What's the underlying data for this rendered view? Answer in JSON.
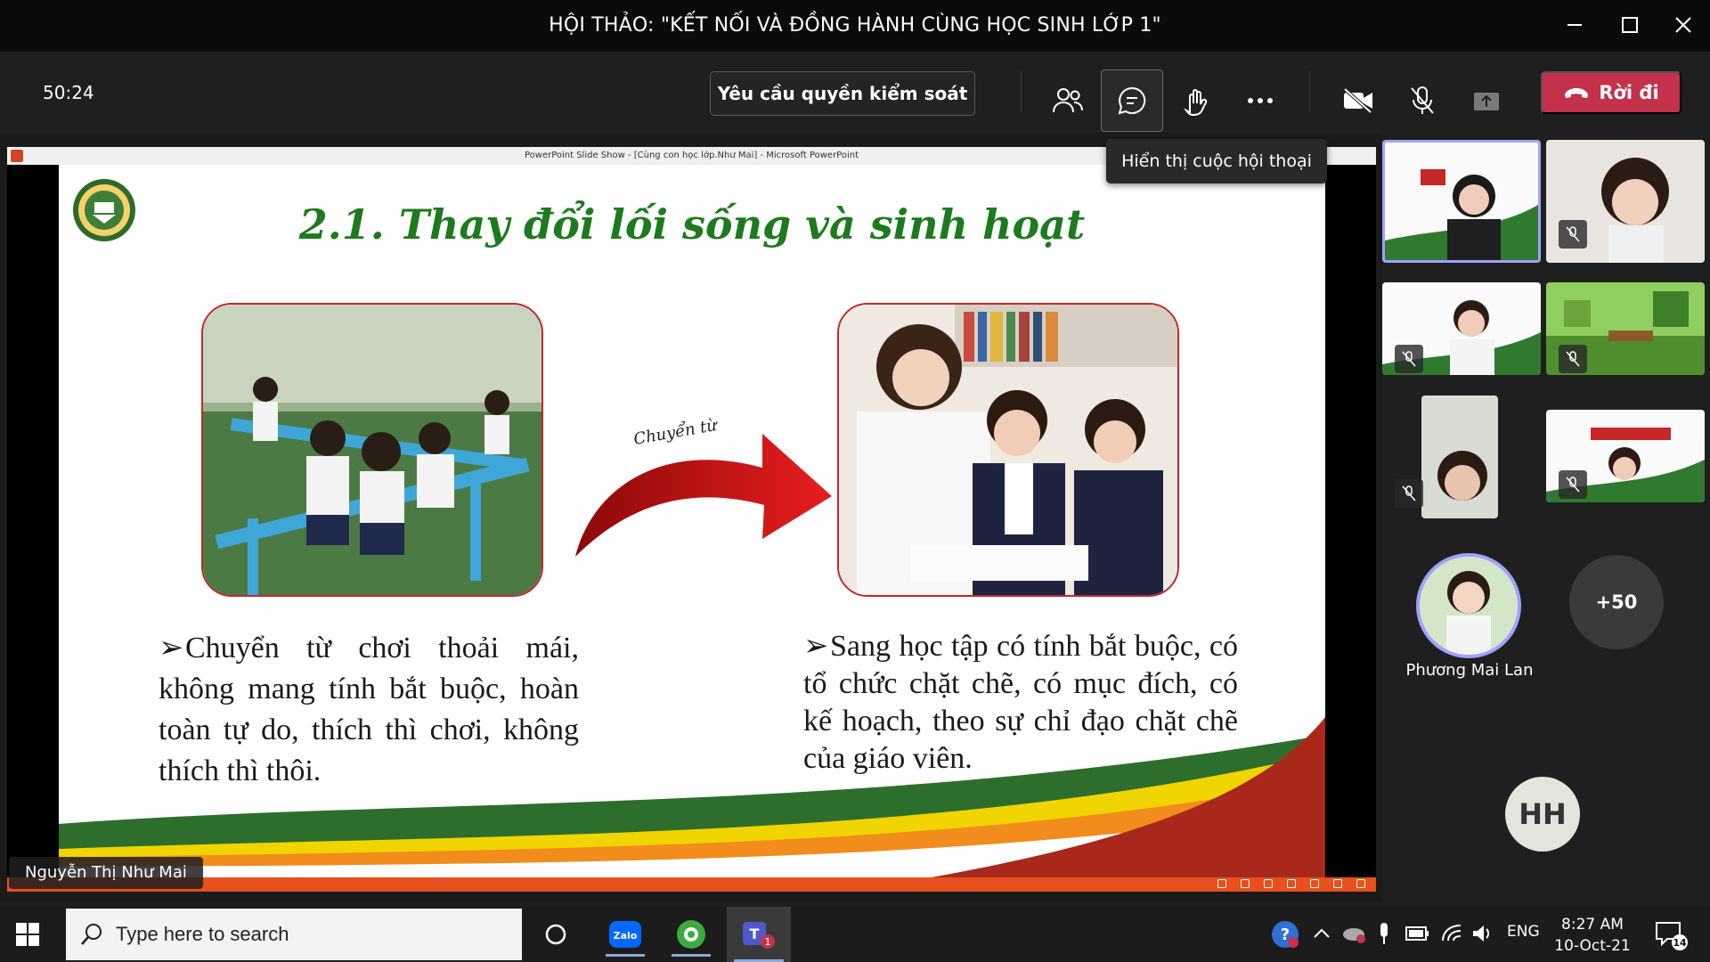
{
  "window": {
    "title": "HỘI THẢO: \"KẾT NỐI VÀ ĐỒNG HÀNH CÙNG HỌC SINH LỚP 1\""
  },
  "toolbar": {
    "timer": "50:24",
    "request_control": "Yêu cầu quyền kiểm soát",
    "leave": "Rời đi",
    "tooltip": "Hiển thị cuộc hội thoại"
  },
  "share": {
    "ppt_title": "PowerPoint Slide Show - [Cùng con học lớp.Như Mai] - Microsoft PowerPoint",
    "presenter": "Nguyễn Thị Như Mai",
    "slide": {
      "title": "2.1.  Thay đổi lối sống và sinh hoạt",
      "arrow_label": "Chuyển từ",
      "left_text": "Chuyển từ chơi thoải mái, không mang tính bắt buộc, hoàn toàn tự do, thích thì chơi, không thích thì thôi.",
      "right_text": "Sang học tập có tính bắt buộc, có tổ chức chặt chẽ, có mục đích, có kế hoạch, theo sự chỉ đạo chặt chẽ của giáo viên."
    }
  },
  "participants": {
    "big_avatar_name": "Phương Mai Lan",
    "more": "+50",
    "initials": "HH"
  },
  "taskbar": {
    "search_placeholder": "Type here to search",
    "zalo": "Zalo",
    "teams_badge": "1",
    "lang": "ENG",
    "time": "8:27 AM",
    "date": "10-Oct-21",
    "notif_count": "14"
  },
  "colors": {
    "leave": "#c4314b",
    "slide_title": "#1e7a1e",
    "frame": "#c0282d",
    "accent_ring": "#9ea2ff"
  }
}
